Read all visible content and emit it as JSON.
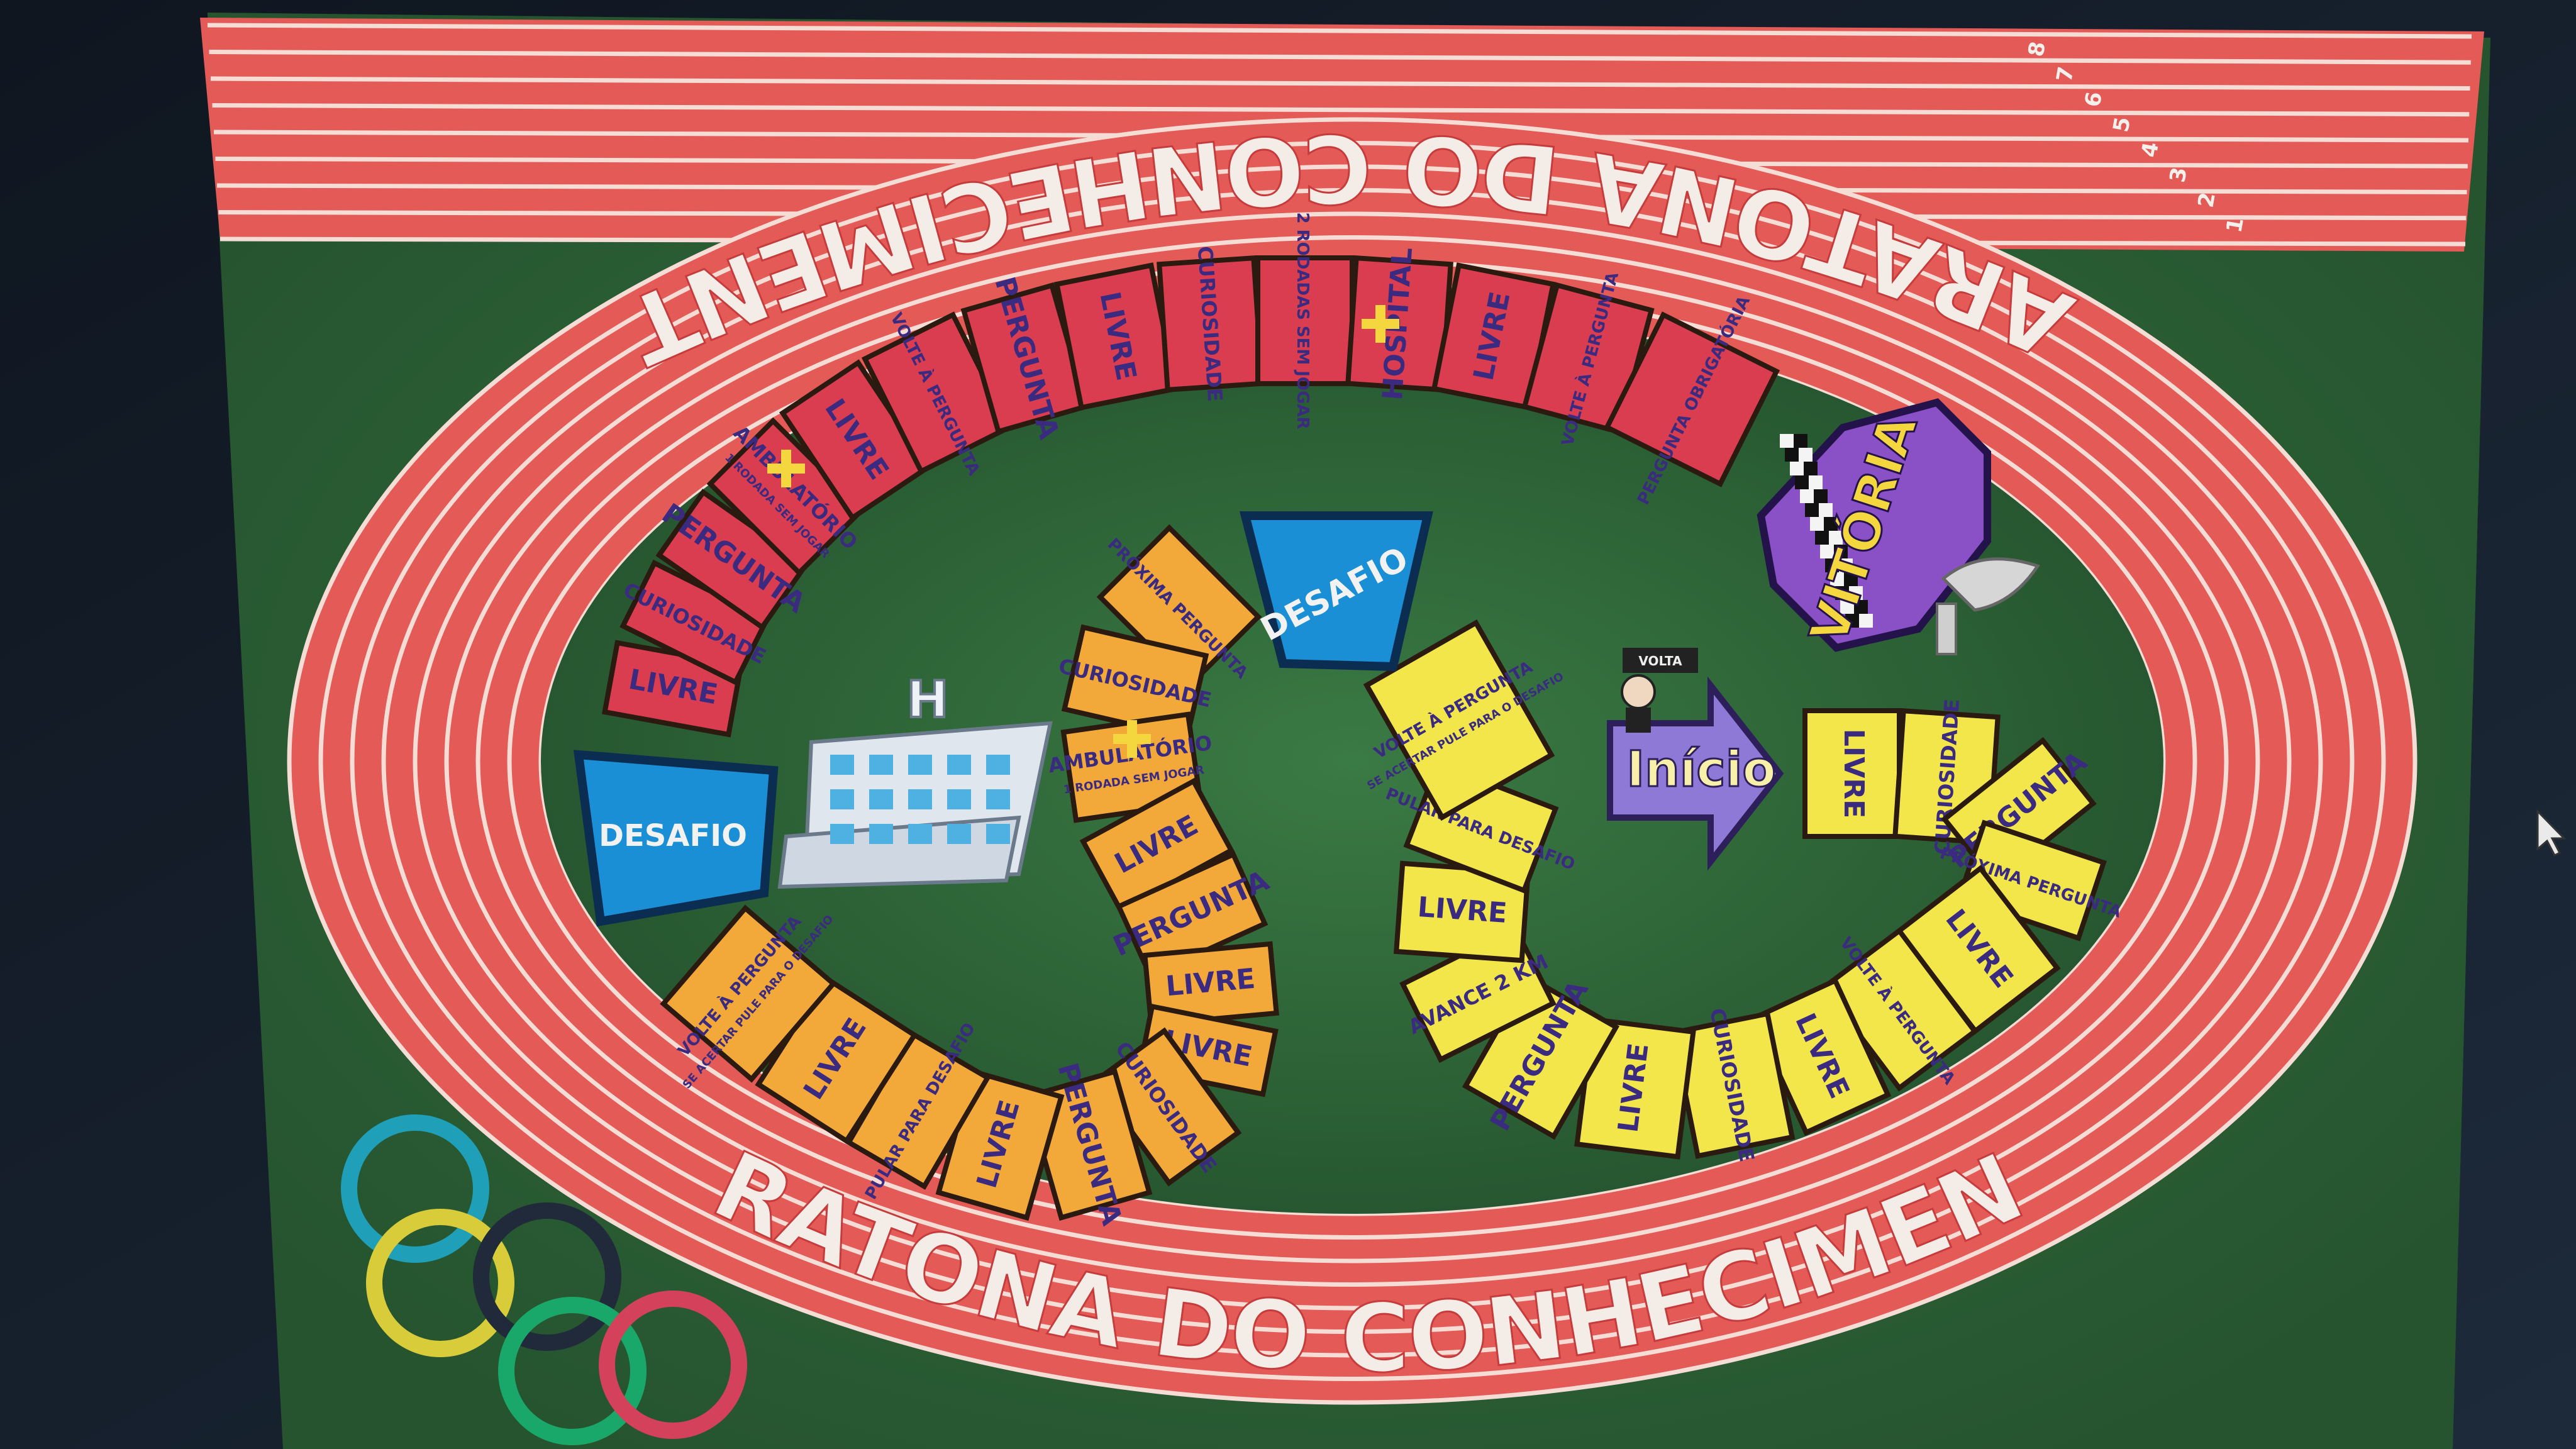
{
  "game_title": "MARATONA DO CONHECIMENTO",
  "lane_numbers": [
    "1",
    "2",
    "3",
    "4",
    "5",
    "6",
    "7",
    "8"
  ],
  "start_label": "Início",
  "start_sign": "VOLTA",
  "finish_label": "VITÓRIA",
  "hospital_sign": "H",
  "colors": {
    "track": "#e0514f",
    "grass": "#2f6b3c",
    "red": "#d93d4f",
    "orange": "#f2a93a",
    "yellow": "#f2e64a",
    "blue": "#1a8fd6",
    "purple": "#8a50c6"
  },
  "yellow_spaces": [
    {
      "id": "y1",
      "label": "LIVRE"
    },
    {
      "id": "y2",
      "label": "CURIOSIDADE"
    },
    {
      "id": "y3",
      "label": "PERGUNTA"
    },
    {
      "id": "y4",
      "label": "PRÓXIMA PERGUNTA"
    },
    {
      "id": "y5",
      "label": "LIVRE"
    },
    {
      "id": "y6",
      "label": "VOLTE À PERGUNTA"
    },
    {
      "id": "y7",
      "label": "LIVRE"
    },
    {
      "id": "y8",
      "label": "CURIOSIDADE"
    },
    {
      "id": "y9",
      "label": "LIVRE"
    },
    {
      "id": "y10",
      "label": "PERGUNTA"
    },
    {
      "id": "y11",
      "label": "AVANCE 2 KM"
    },
    {
      "id": "y12",
      "label": "LIVRE"
    },
    {
      "id": "y13",
      "label": "PULAR PARA DESAFIO"
    },
    {
      "id": "y14",
      "label": "VOLTE À PERGUNTA",
      "sub": "SE ACERTAR PULE PARA O DESAFIO"
    }
  ],
  "blue_center": {
    "label": "DESAFIO"
  },
  "orange_spaces": [
    {
      "id": "o1",
      "label": "PRÓXIMA PERGUNTA"
    },
    {
      "id": "o2",
      "label": "CURIOSIDADE"
    },
    {
      "id": "o3",
      "label": "AMBULATÓRIO",
      "sub": "1 RODADA SEM JOGAR"
    },
    {
      "id": "o4",
      "label": "LIVRE"
    },
    {
      "id": "o5",
      "label": "PERGUNTA"
    },
    {
      "id": "o6",
      "label": "LIVRE"
    },
    {
      "id": "o7",
      "label": "LIVRE"
    },
    {
      "id": "o8",
      "label": "CURIOSIDADE"
    },
    {
      "id": "o9",
      "label": "PERGUNTA"
    },
    {
      "id": "o10",
      "label": "LIVRE"
    },
    {
      "id": "o11",
      "label": "PULAR PARA DESAFIO"
    },
    {
      "id": "o12",
      "label": "LIVRE"
    },
    {
      "id": "o13",
      "label": "VOLTE À PERGUNTA",
      "sub": "SE ACERTAR PULE PARA O DESAFIO"
    }
  ],
  "blue_left": {
    "label": "DESAFIO"
  },
  "red_spaces": [
    {
      "id": "r1",
      "label": "LIVRE"
    },
    {
      "id": "r2",
      "label": "CURIOSIDADE"
    },
    {
      "id": "r3",
      "label": "PERGUNTA"
    },
    {
      "id": "r4",
      "label": "AMBULATÓRIO",
      "sub": "1 RODADA SEM JOGAR"
    },
    {
      "id": "r5",
      "label": "LIVRE"
    },
    {
      "id": "r6",
      "label": "VOLTE À PERGUNTA"
    },
    {
      "id": "r7",
      "label": "PERGUNTA"
    },
    {
      "id": "r8",
      "label": "LIVRE"
    },
    {
      "id": "r9",
      "label": "CURIOSIDADE"
    },
    {
      "id": "r10",
      "label": "2 RODADAS SEM JOGAR"
    },
    {
      "id": "r11",
      "label": "HOSPITAL"
    },
    {
      "id": "r12",
      "label": "LIVRE"
    },
    {
      "id": "r13",
      "label": "VOLTE À PERGUNTA"
    },
    {
      "id": "r14",
      "label": "PERGUNTA OBRIGATÓRIA"
    }
  ]
}
